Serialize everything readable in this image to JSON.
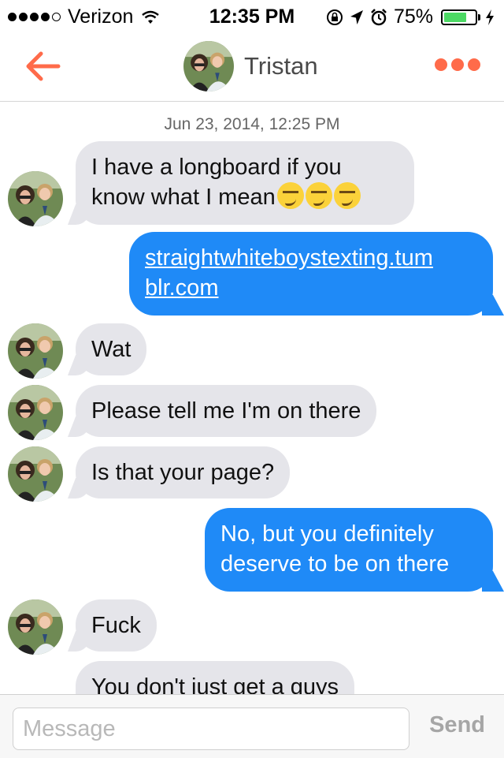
{
  "status_bar": {
    "carrier": "Verizon",
    "signal_bars": 4,
    "time": "12:35 PM",
    "battery_percent": "75%",
    "battery_level": 0.75
  },
  "nav": {
    "contact_name": "Tristan"
  },
  "conversation": {
    "date": "Jun 23, 2014, 12:25 PM",
    "messages": [
      {
        "from": "them",
        "text_line1": "I have a longboard if you",
        "text_line2": "know what I mean"
      },
      {
        "from": "me",
        "text_line1": "straightwhiteboystexting.tum",
        "text_line2": "blr.com"
      },
      {
        "from": "them",
        "text": "Wat"
      },
      {
        "from": "them",
        "text": "Please tell me I'm on there"
      },
      {
        "from": "them",
        "text": "Is that your page?"
      },
      {
        "from": "me",
        "text_line1": "No, but you definitely",
        "text_line2": "deserve to be on there"
      },
      {
        "from": "them",
        "text": "Fuck"
      },
      {
        "from": "them",
        "text": "You don't just get a guys"
      }
    ]
  },
  "composer": {
    "placeholder": "Message",
    "send_label": "Send"
  },
  "colors": {
    "accent": "#ff6b4a",
    "outgoing_bubble": "#1f8af7",
    "incoming_bubble": "#e5e5ea"
  }
}
